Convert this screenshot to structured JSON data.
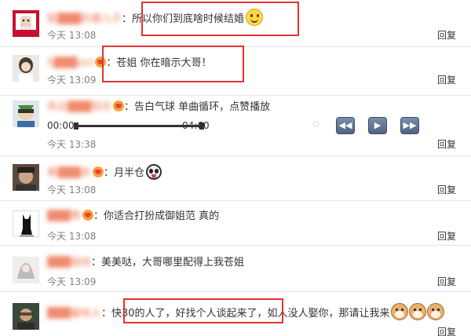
{
  "comments": [
    {
      "username": "莸▓▓▓的傻儿子",
      "text": "：所以你们到底啥时候结婚",
      "time": "今天 13:08",
      "reply": "回复",
      "emoji": "smile-emoji"
    },
    {
      "username": "S▓▓▓sicl",
      "text": "：苍姐 你在暗示大哥！",
      "time": "今天 13:09",
      "reply": "回复"
    },
    {
      "username": "布达▓▓▓阳光",
      "text": "：告白气球 单曲循环，点赞播放",
      "time": "今天 13:38",
      "reply": "回复"
    },
    {
      "username": "希▓▓▓杀",
      "text": "：月半仓",
      "time": "今天 13:08",
      "reply": "回复",
      "emoji": "panda-emoji"
    },
    {
      "username": "▓▓▓哥",
      "text": "：你适合打扮成御姐范  真的",
      "time": "今天 13:08",
      "reply": "回复"
    },
    {
      "username": "▓▓▓喆炫",
      "text": "：美美哒，大哥哪里配得上我苍姐",
      "time": "今天 13:09",
      "reply": "回复"
    },
    {
      "username": "▓▓▓最呛人",
      "text": "：快30的人了，好找个人谈起来了，如人没人娶你，那请让我来",
      "reply": "回复",
      "emoji": "dog-emoji"
    }
  ],
  "player": {
    "start_time": "00:00",
    "end_time": "04:60"
  },
  "colors": {
    "username": "#eb7350",
    "highlight_box": "#e0342f",
    "time": "#808080"
  }
}
